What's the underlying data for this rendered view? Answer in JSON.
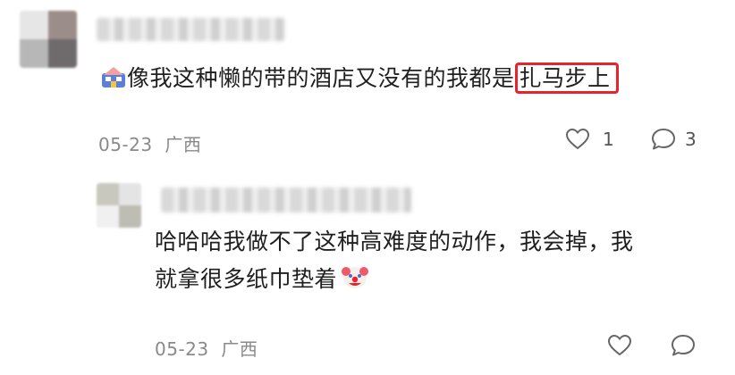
{
  "comment": {
    "text_before_highlight": "像我这种懒的带的酒店又没有的我都是",
    "text_highlight": "扎马步上",
    "date": "05-23",
    "location": "广西",
    "like_count": "1",
    "reply_count": "3",
    "icon": "hotel-emoji-icon"
  },
  "reply": {
    "line1": "哈哈哈我做不了这种高难度的动作，我会掉，我",
    "line2": "就拿很多纸巾垫着",
    "date": "05-23",
    "location": "广西",
    "icon": "clown-face-icon"
  },
  "colors": {
    "highlight_border": "#e8232b",
    "meta_text": "#8a8a8a"
  }
}
